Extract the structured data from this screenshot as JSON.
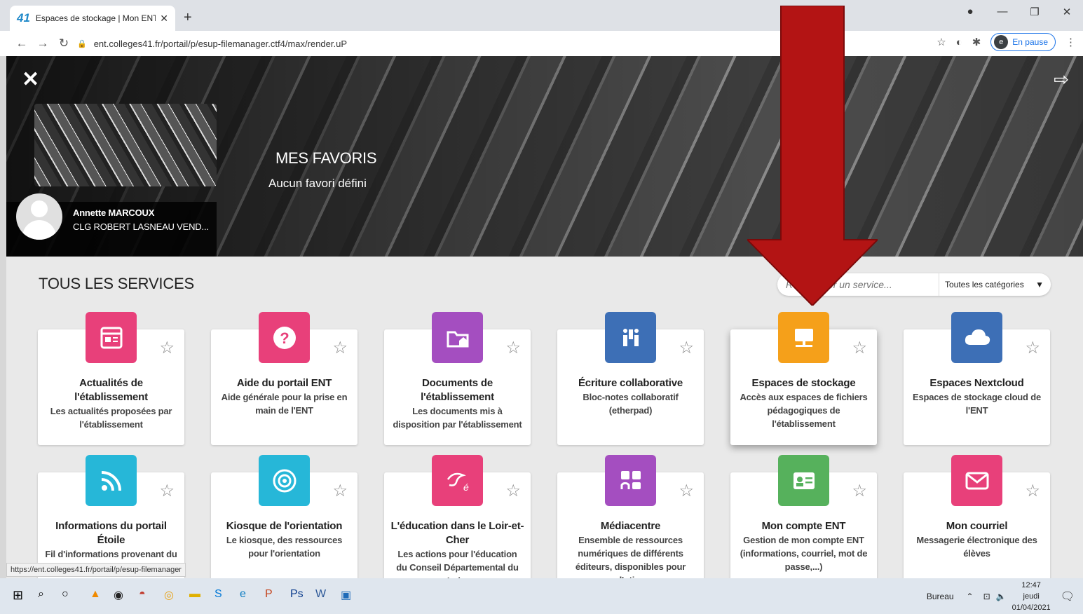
{
  "browser": {
    "tab_title": "Espaces de stockage | Mon ENT",
    "tab_favicon": "41",
    "url": "ent.colleges41.fr/portail/p/esup-filemanager.ctf4/max/render.uP",
    "profile_button": "En pause",
    "profile_initial": "e"
  },
  "header": {
    "favorites_title": "MES FAVORIS",
    "favorites_empty": "Aucun favori défini"
  },
  "user": {
    "name": "Annette MARCOUX",
    "school": "CLG ROBERT LASNEAU VEND..."
  },
  "services": {
    "title": "TOUS LES SERVICES",
    "search_placeholder": "Rechercher un service...",
    "category_select": "Toutes les catégories",
    "cards": [
      {
        "title": "Actualités de l'établissement",
        "desc": "Les actualités proposées par l'établissement",
        "color": "#e8407a",
        "icon": "news-icon"
      },
      {
        "title": "Aide du portail ENT",
        "desc": "Aide générale pour la prise en main de l'ENT",
        "color": "#e8407a",
        "icon": "help-icon"
      },
      {
        "title": "Documents de l'établissement",
        "desc": "Les documents mis à disposition par l'établissement",
        "color": "#a44ec0",
        "icon": "folder-icon"
      },
      {
        "title": "Écriture collaborative",
        "desc": "Bloc-notes collaboratif (etherpad)",
        "color": "#3d6fb6",
        "icon": "collab-icon"
      },
      {
        "title": "Espaces de stockage",
        "desc": "Accès aux espaces de fichiers pédagogiques de l'établissement",
        "color": "#f5a01a",
        "icon": "storage-icon"
      },
      {
        "title": "Espaces Nextcloud",
        "desc": "Espaces de stockage cloud de l'ENT",
        "color": "#3d6fb6",
        "icon": "cloud-icon"
      },
      {
        "title": "Informations du portail Étoile",
        "desc": "Fil d'informations provenant du",
        "color": "#26b7d8",
        "icon": "rss-icon"
      },
      {
        "title": "Kiosque de l'orientation",
        "desc": "Le kiosque, des ressources pour l'orientation",
        "color": "#26b7d8",
        "icon": "target-icon"
      },
      {
        "title": "L'éducation dans le Loir-et-Cher",
        "desc": "Les actions pour l'éducation du Conseil Départemental du Loi...",
        "color": "#e8407a",
        "icon": "education-icon"
      },
      {
        "title": "Médiacentre",
        "desc": "Ensemble de ressources numériques de différents éditeurs, disponibles pour l'uti...",
        "color": "#a44ec0",
        "icon": "media-icon"
      },
      {
        "title": "Mon compte ENT",
        "desc": "Gestion de mon compte ENT (informations, courriel, mot de passe,...)",
        "color": "#56b15c",
        "icon": "account-icon"
      },
      {
        "title": "Mon courriel",
        "desc": "Messagerie électronique des élèves",
        "color": "#e8407a",
        "icon": "mail-icon"
      }
    ]
  },
  "status_bar": "https://ent.colleges41.fr/portail/p/esup-filemanager",
  "taskbar": {
    "desktop_label": "Bureau",
    "time": "12:47",
    "day": "jeudi",
    "date": "01/04/2021"
  }
}
